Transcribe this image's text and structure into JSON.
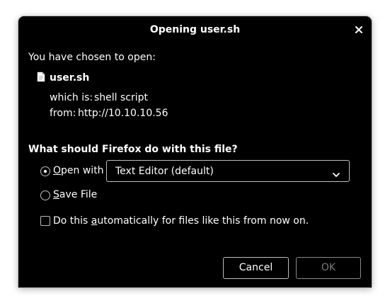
{
  "dialog": {
    "title": "Opening user.sh",
    "intro": "You have chosen to open:",
    "file": {
      "name": "user.sh",
      "type_label": "which is:",
      "type_value": "shell script",
      "from_label": "from:",
      "from_value": "http://10.10.10.56"
    },
    "question": "What should Firefox do with this file?",
    "open_with": {
      "label_prefix": "",
      "accel": "O",
      "label_rest": "pen with",
      "selected": true,
      "app": "Text Editor (default)"
    },
    "save_file": {
      "accel": "S",
      "label_rest": "ave File",
      "selected": false
    },
    "auto": {
      "label_before": "Do this ",
      "accel": "a",
      "label_after": "utomatically for files like this from now on.",
      "checked": false
    },
    "buttons": {
      "cancel": "Cancel",
      "ok": "OK"
    }
  },
  "colors": {
    "background": "#000000",
    "text": "#ffffff",
    "border": "#bdbdbd",
    "disabled_text": "#7a7a7a"
  }
}
